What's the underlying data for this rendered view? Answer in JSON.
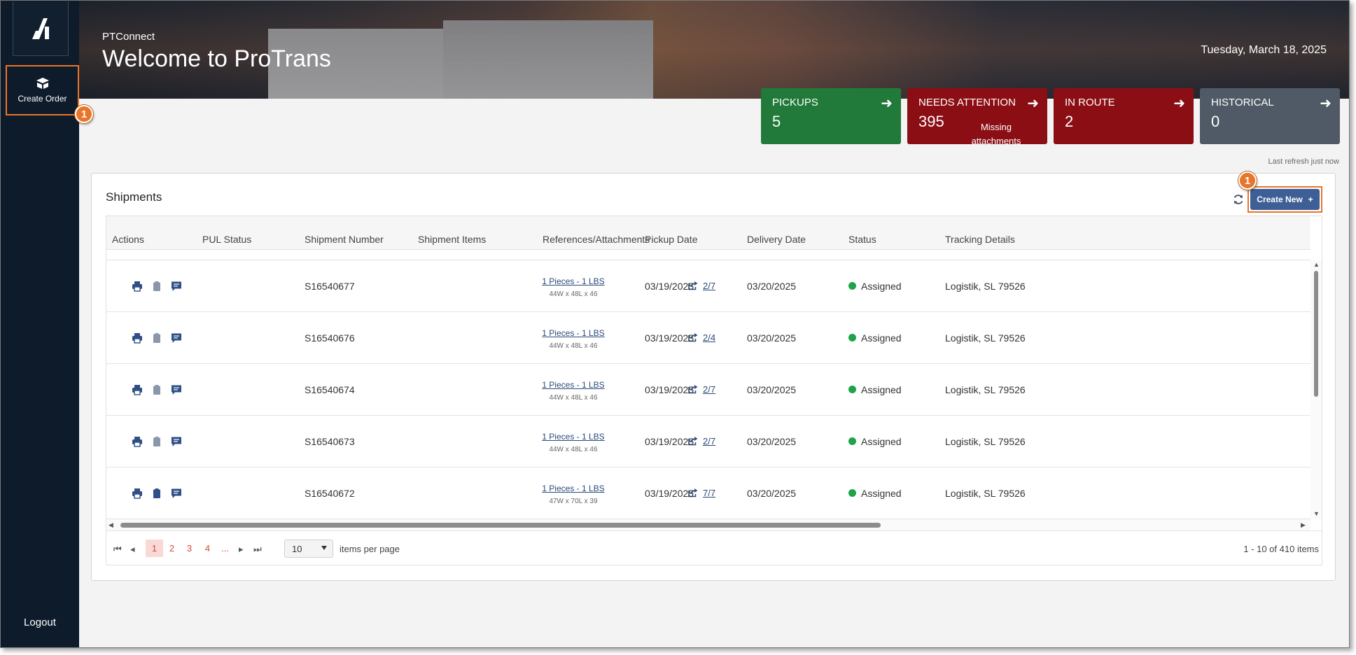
{
  "sidebar": {
    "create_order_label": "Create Order",
    "logout_label": "Logout"
  },
  "callouts": {
    "badge_number": "1"
  },
  "header": {
    "brand_sub": "PTConnect",
    "title": "Welcome to ProTrans",
    "date": "Tuesday, March 18, 2025"
  },
  "stats": [
    {
      "label": "PICKUPS",
      "value": "5",
      "color": "#217a3a"
    },
    {
      "label": "NEEDS ATTENTION",
      "value": "395",
      "sub": "Missing attachments",
      "color": "#8b0e14"
    },
    {
      "label": "IN ROUTE",
      "value": "2",
      "color": "#8b0e14"
    },
    {
      "label": "HISTORICAL",
      "value": "0",
      "color": "#4f5a66"
    }
  ],
  "last_refresh": "Last refresh just now",
  "panel": {
    "title": "Shipments",
    "create_new_label": "Create New",
    "create_new_plus": "+"
  },
  "table": {
    "columns": [
      "Actions",
      "PUL Status",
      "Shipment Number",
      "Shipment Items",
      "References/Attachments",
      "Pickup Date",
      "Delivery Date",
      "Status",
      "Tracking Details"
    ],
    "rows": [
      {
        "shipment": "S16540677",
        "items": "1 Pieces - 1 LBS",
        "dims": "44W x 48L x 46",
        "refs": "2/7",
        "pickup": "03/19/2025",
        "delivery": "03/20/2025",
        "status": "Assigned",
        "tracking": "Logistik, SL 79526"
      },
      {
        "shipment": "S16540676",
        "items": "1 Pieces - 1 LBS",
        "dims": "44W x 48L x 46",
        "refs": "2/4",
        "pickup": "03/19/2025",
        "delivery": "03/20/2025",
        "status": "Assigned",
        "tracking": "Logistik, SL 79526"
      },
      {
        "shipment": "S16540674",
        "items": "1 Pieces - 1 LBS",
        "dims": "44W x 48L x 46",
        "refs": "2/7",
        "pickup": "03/19/2025",
        "delivery": "03/20/2025",
        "status": "Assigned",
        "tracking": "Logistik, SL 79526"
      },
      {
        "shipment": "S16540673",
        "items": "1 Pieces - 1 LBS",
        "dims": "44W x 48L x 46",
        "refs": "2/7",
        "pickup": "03/19/2025",
        "delivery": "03/20/2025",
        "status": "Assigned",
        "tracking": "Logistik, SL 79526"
      },
      {
        "shipment": "S16540672",
        "items": "1 Pieces - 1 LBS",
        "dims": "47W x 70L x 39",
        "refs": "7/7",
        "pickup": "03/19/2025",
        "delivery": "03/20/2025",
        "status": "Assigned",
        "tracking": "Logistik, SL 79526"
      }
    ]
  },
  "pager": {
    "pages": [
      "1",
      "2",
      "3",
      "4",
      "..."
    ],
    "per_page": "10",
    "per_page_label": "items per page",
    "info": "1 - 10 of 410 items"
  },
  "colors": {
    "accent": "#e8752a",
    "primary": "#3d5f96",
    "link": "#2a4a7a",
    "status_green": "#1ea34a",
    "sidebar": "#0e1b2a"
  }
}
